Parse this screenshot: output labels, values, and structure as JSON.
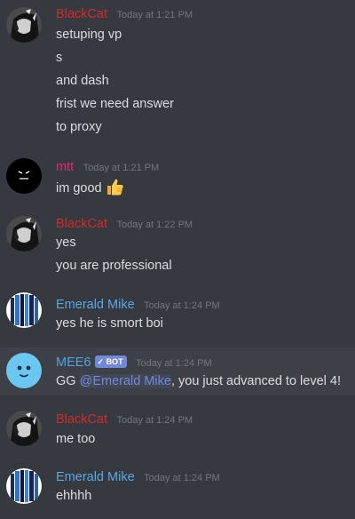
{
  "colors": {
    "background": "#36393f",
    "blackcat": "#d12b2b",
    "mtt": "#dd2e72",
    "emerald": "#5aa6e3",
    "mee6": "#4ca6e0",
    "text": "#dcddde",
    "timestamp": "#72767d",
    "mention": "#7289da"
  },
  "messages": [
    {
      "author": "BlackCat",
      "avatar_icon": "dark-anime-avatar-icon",
      "timestamp": "Today at 1:21 PM",
      "lines": [
        "setuping vp",
        "s",
        "and dash",
        "frist we need answer",
        "to proxy"
      ]
    },
    {
      "author": "mtt",
      "avatar_icon": "black-face-avatar-icon",
      "timestamp": "Today at 1:21 PM",
      "lines": [
        "im good"
      ],
      "emoji": "thumbs-up-icon"
    },
    {
      "author": "BlackCat",
      "avatar_icon": "dark-anime-avatar-icon",
      "timestamp": "Today at 1:22 PM",
      "lines": [
        "yes",
        "you are professional"
      ]
    },
    {
      "author": "Emerald Mike",
      "avatar_icon": "striped-avatar-icon",
      "timestamp": "Today at 1:24 PM",
      "lines": [
        "yes he is smort boi"
      ]
    },
    {
      "author": "MEE6",
      "avatar_icon": "mee6-face-avatar-icon",
      "bot_tag": "BOT",
      "timestamp": "Today at 1:24 PM",
      "text_prefix": "GG ",
      "mention": "@Emerald Mike",
      "text_suffix": ", you just advanced to level 4!"
    },
    {
      "author": "BlackCat",
      "avatar_icon": "dark-anime-avatar-icon",
      "timestamp": "Today at 1:24 PM",
      "lines": [
        "me too"
      ]
    },
    {
      "author": "Emerald Mike",
      "avatar_icon": "striped-avatar-icon",
      "timestamp": "Today at 1:24 PM",
      "lines": [
        "ehhhh"
      ]
    }
  ]
}
